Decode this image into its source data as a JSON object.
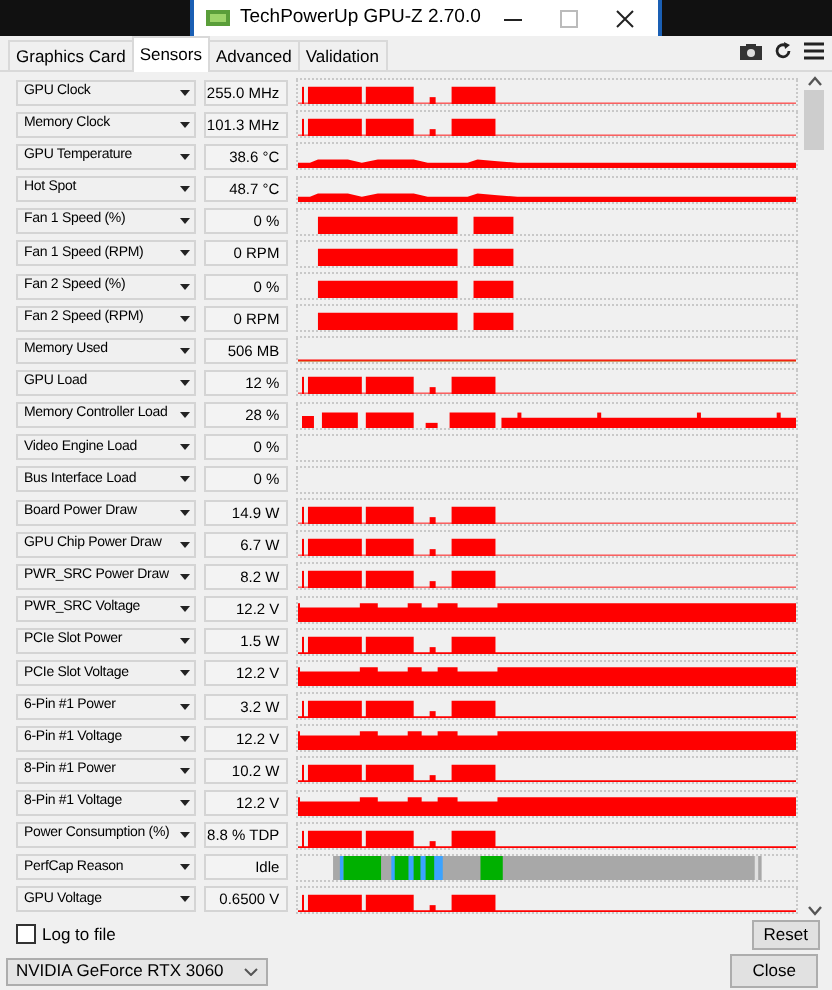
{
  "window": {
    "title": "TechPowerUp GPU-Z 2.70.0"
  },
  "tabs": [
    {
      "label": "Graphics Card",
      "selected": false
    },
    {
      "label": "Sensors",
      "selected": true
    },
    {
      "label": "Advanced",
      "selected": false
    },
    {
      "label": "Validation",
      "selected": false
    }
  ],
  "sensors": [
    {
      "name": "GPU Clock",
      "value": "255.0 MHz",
      "kind": "graph"
    },
    {
      "name": "Memory Clock",
      "value": "101.3 MHz",
      "kind": "graph"
    },
    {
      "name": "GPU Temperature",
      "value": "38.6 °C",
      "kind": "graph"
    },
    {
      "name": "Hot Spot",
      "value": "48.7 °C",
      "kind": "graph"
    },
    {
      "name": "Fan 1 Speed (%)",
      "value": "0 %",
      "kind": "graph"
    },
    {
      "name": "Fan 1 Speed (RPM)",
      "value": "0 RPM",
      "kind": "graph"
    },
    {
      "name": "Fan 2 Speed (%)",
      "value": "0 %",
      "kind": "graph"
    },
    {
      "name": "Fan 2 Speed (RPM)",
      "value": "0 RPM",
      "kind": "graph"
    },
    {
      "name": "Memory Used",
      "value": "506 MB",
      "kind": "graph"
    },
    {
      "name": "GPU Load",
      "value": "12 %",
      "kind": "graph"
    },
    {
      "name": "Memory Controller Load",
      "value": "28 %",
      "kind": "graph"
    },
    {
      "name": "Video Engine Load",
      "value": "0 %",
      "kind": "graph"
    },
    {
      "name": "Bus Interface Load",
      "value": "0 %",
      "kind": "graph"
    },
    {
      "name": "Board Power Draw",
      "value": "14.9 W",
      "kind": "graph"
    },
    {
      "name": "GPU Chip Power Draw",
      "value": "6.7 W",
      "kind": "graph"
    },
    {
      "name": "PWR_SRC Power Draw",
      "value": "8.2 W",
      "kind": "graph"
    },
    {
      "name": "PWR_SRC Voltage",
      "value": "12.2 V",
      "kind": "graph"
    },
    {
      "name": "PCIe Slot Power",
      "value": "1.5 W",
      "kind": "graph"
    },
    {
      "name": "PCIe Slot Voltage",
      "value": "12.2 V",
      "kind": "graph"
    },
    {
      "name": "6-Pin #1 Power",
      "value": "3.2 W",
      "kind": "graph"
    },
    {
      "name": "6-Pin #1 Voltage",
      "value": "12.2 V",
      "kind": "graph"
    },
    {
      "name": "8-Pin #1 Power",
      "value": "10.2 W",
      "kind": "graph"
    },
    {
      "name": "8-Pin #1 Voltage",
      "value": "12.2 V",
      "kind": "graph"
    },
    {
      "name": "Power Consumption (%)",
      "value": "8.8 % TDP",
      "kind": "graph"
    },
    {
      "name": "PerfCap Reason",
      "value": "Idle",
      "kind": "perfcap"
    },
    {
      "name": "GPU Voltage",
      "value": "0.6500 V",
      "kind": "graph"
    }
  ],
  "log_to_file": {
    "label": "Log to file",
    "checked": false
  },
  "reset_button": "Reset",
  "gpu_select": {
    "value": "NVIDIA GeForce RTX 3060"
  },
  "close_button": "Close"
}
